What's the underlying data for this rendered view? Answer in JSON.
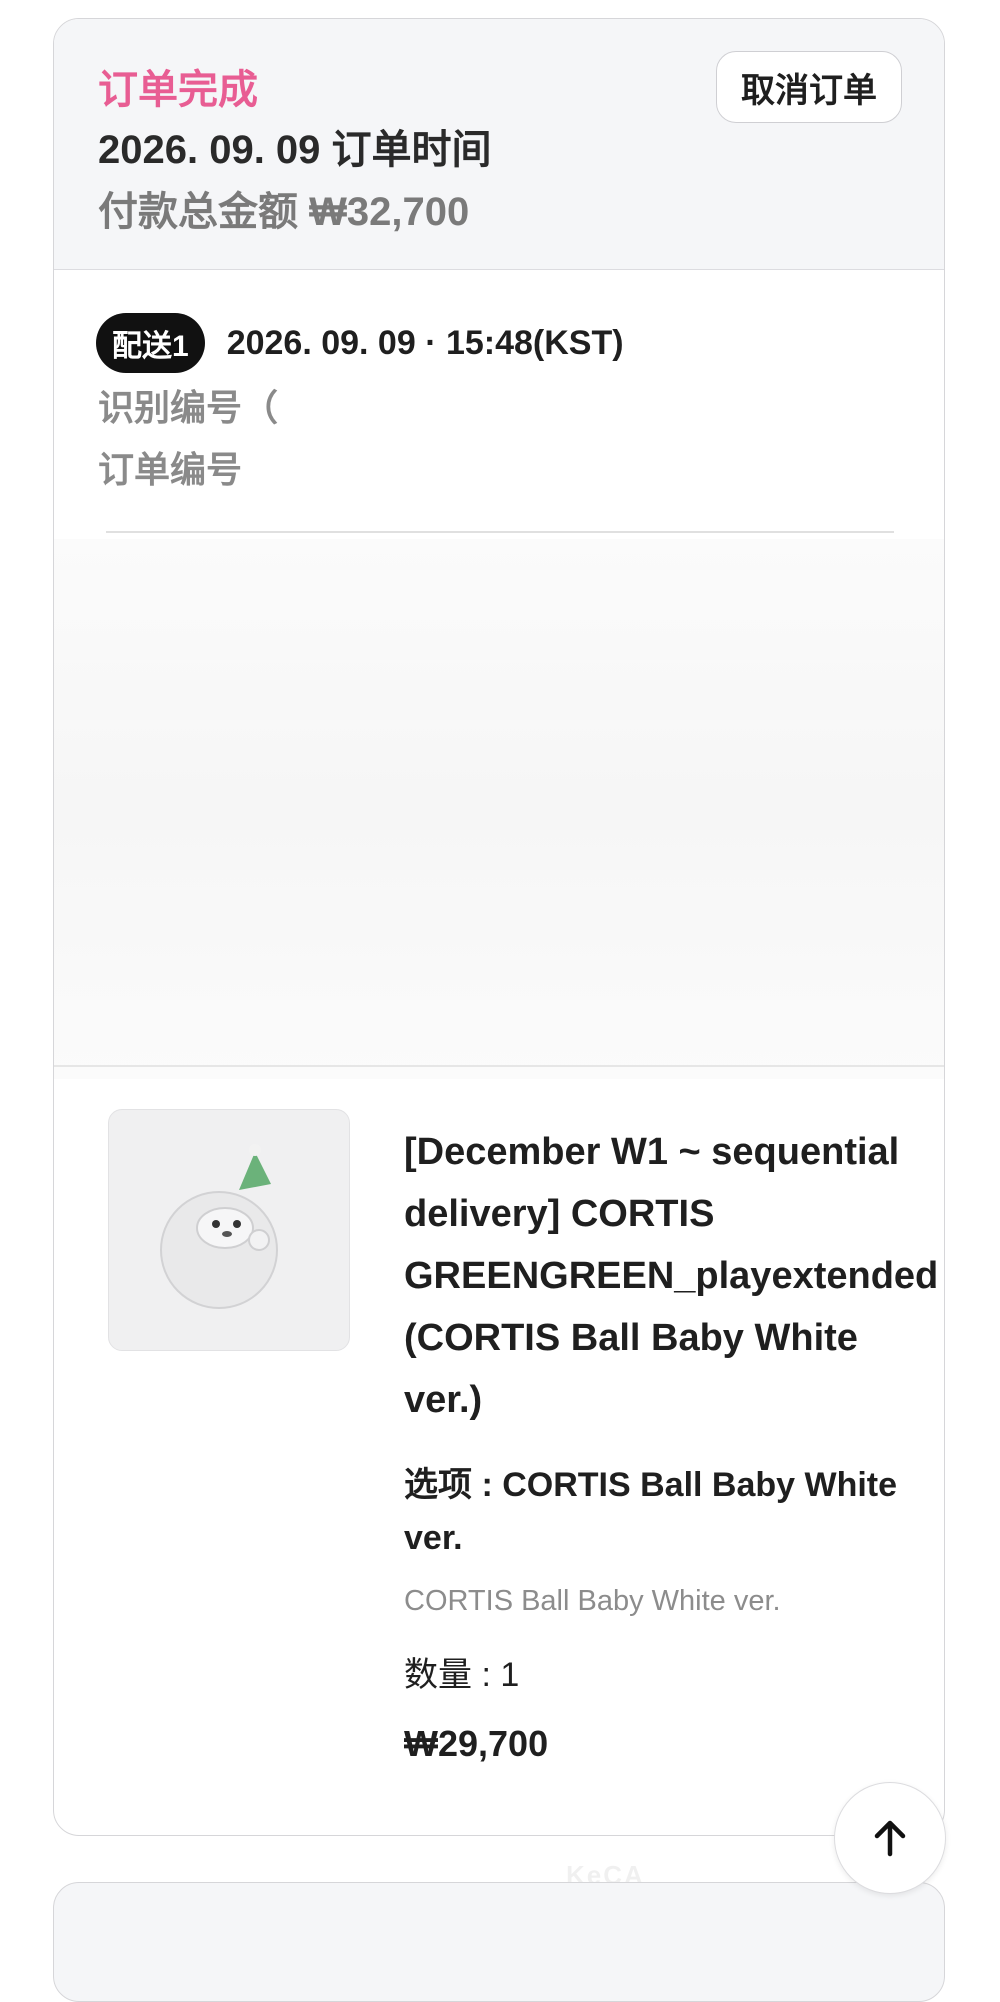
{
  "order": {
    "status": "订单完成",
    "order_time": "2026. 09. 09 订单时间",
    "total_paid": "付款总金额 ₩32,700",
    "cancel_label": "取消订单"
  },
  "shipment": {
    "badge": "配送1",
    "datetime": "2026. 09. 09 · 15:48(KST)",
    "id_label": "识别编号（",
    "order_no_label": "订单编号"
  },
  "product": {
    "title": "[December W1 ~ sequential delivery] CORTIS GREENGREEN_playextended (CORTIS Ball Baby White ver.)",
    "option": "选项 : CORTIS Ball Baby White ver.",
    "option_sub": "CORTIS Ball Baby White ver.",
    "quantity": "数量 : 1",
    "price": "₩29,700",
    "thumb_icon": "plush-ball-icon"
  },
  "colors": {
    "status_pink": "#e85d93",
    "badge_black": "#111111"
  }
}
